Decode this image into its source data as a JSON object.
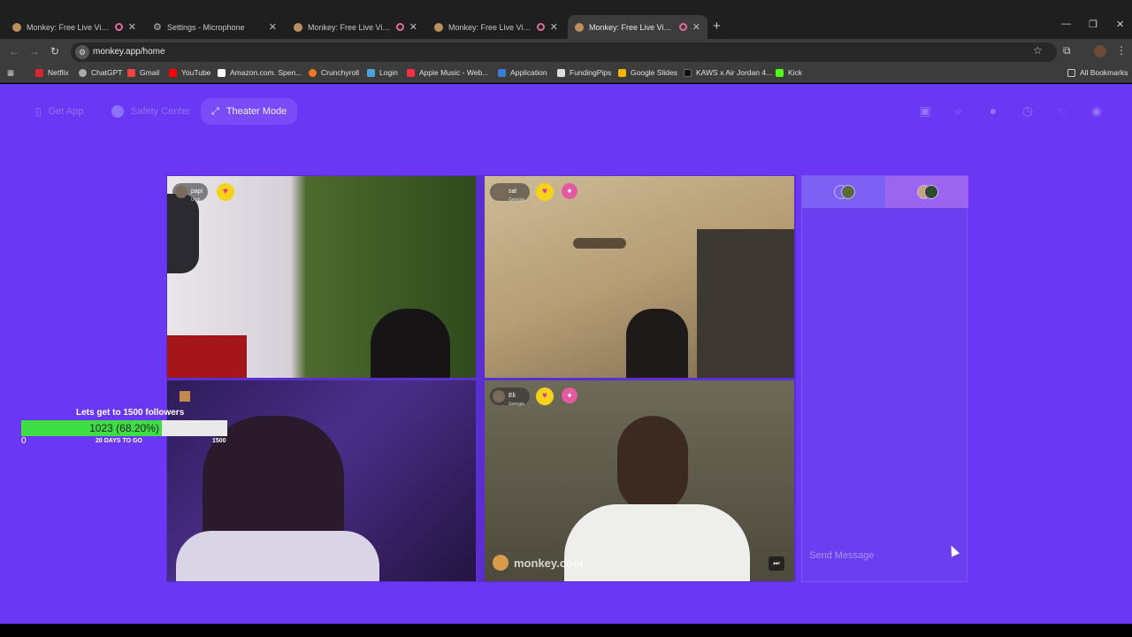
{
  "browser": {
    "tabs": [
      {
        "title": "Monkey: Free Live Video Ch",
        "recording": true
      },
      {
        "title": "Settings - Microphone",
        "recording": false
      },
      {
        "title": "Monkey: Free Live Video Ch",
        "recording": true
      },
      {
        "title": "Monkey: Free Live Video Ch",
        "recording": true
      },
      {
        "title": "Monkey: Free Live Video Ch",
        "recording": true
      }
    ],
    "url": "monkey.app/home",
    "bookmarks": [
      "Netflix",
      "ChatGPT",
      "Gmail",
      "YouTube",
      "Amazon.com. Spen...",
      "Crunchyroll",
      "Login",
      "Apple Music - Web...",
      "Application",
      "FundingPips",
      "Google Slides",
      "KAWS x Air Jordan 4...",
      "Kick"
    ],
    "all_bookmarks": "All Bookmarks"
  },
  "app": {
    "nav": {
      "get_app": "Get App",
      "safety_center": "Safety Center",
      "theater_mode": "Theater Mode"
    },
    "participants": [
      {
        "name": "papi",
        "location": "Utah"
      },
      {
        "name": "sal",
        "location": "Georgia"
      },
      {
        "name": "Eli",
        "location": "Georgia"
      }
    ],
    "chat": {
      "placeholder": "Send Message"
    },
    "watermark": "monkey.cool"
  },
  "overlay": {
    "goal_label": "Lets get to 1500 followers",
    "progress_fraction": 0.682,
    "progress_text": "1023 (68.20%)",
    "min": "0",
    "days_left": "20 DAYS TO GO",
    "max": "1500"
  },
  "colors": {
    "page_bg": "#6a37f5",
    "progress_fill": "#3ddd45",
    "heart": "#f7d21a",
    "gift": "#e25aa0"
  }
}
